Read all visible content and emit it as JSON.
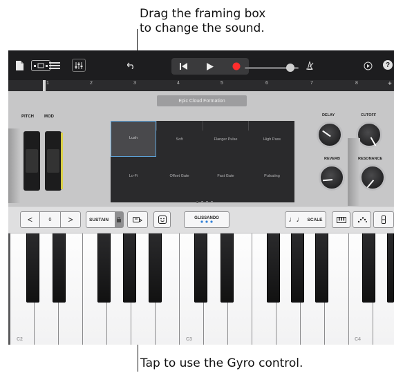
{
  "callouts": {
    "top_line1": "Drag the framing box",
    "top_line2": "to change the sound.",
    "bottom": "Tap to use the Gyro control."
  },
  "toolbar": {
    "items": [
      "my-songs",
      "browser-view",
      "tracks-view",
      "mixer",
      "undo",
      "go-to-beginning",
      "play",
      "record",
      "volume",
      "metronome",
      "loop",
      "help"
    ],
    "record_color": "#ff2d2d",
    "volume_level": 0.85,
    "help": "?"
  },
  "ruler": {
    "markers": [
      "1",
      "2",
      "3",
      "4",
      "5",
      "6",
      "7",
      "8"
    ],
    "add": "+"
  },
  "instrument": {
    "preset": "Epic Cloud Formation",
    "pitch_label": "PITCH",
    "mod_label": "MOD",
    "pad": {
      "row1": [
        "Lush",
        "Soft",
        "Flanger Pulse",
        "High Pass"
      ],
      "row2": [
        "Lo-Fi",
        "Offset Gate",
        "Fast Gate",
        "Pulsating"
      ]
    },
    "page_dots": 4,
    "knobs": {
      "delay": "DELAY",
      "cutoff": "CUTOFF",
      "reverb": "REVERB",
      "resonance": "RESONANCE"
    }
  },
  "controls": {
    "octave_down": "<",
    "octave_value": "0",
    "octave_up": ">",
    "sustain": "SUSTAIN",
    "glissando": "GLISSANDO",
    "scale": "SCALE",
    "accent": "#2f7fd6"
  },
  "keyboard": {
    "labels": [
      "C2",
      "C3",
      "C4"
    ]
  }
}
